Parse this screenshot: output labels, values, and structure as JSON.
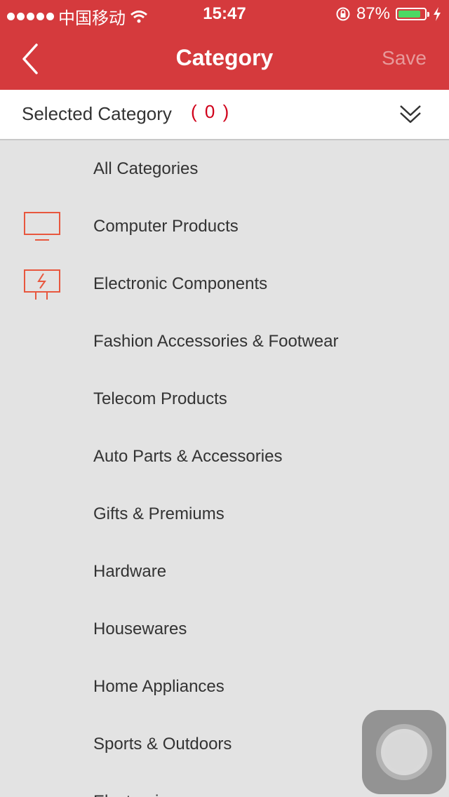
{
  "status_bar": {
    "carrier": "中国移动",
    "time": "15:47",
    "battery": "87%",
    "battery_level": 0.87,
    "signal_icon": "signal-dots-icon",
    "wifi_icon": "wifi-icon",
    "lock_icon": "rotation-lock-icon",
    "charging_icon": "charging-bolt-icon"
  },
  "nav": {
    "title": "Category",
    "save_label": "Save",
    "back_icon": "chevron-left-icon"
  },
  "selected": {
    "label": "Selected Category",
    "count": "( 0 )",
    "expand_icon": "double-chevron-down-icon"
  },
  "categories": [
    {
      "label": "All Categories",
      "icon": ""
    },
    {
      "label": "Computer Products",
      "icon": "monitor-icon"
    },
    {
      "label": "Electronic Components",
      "icon": "circuit-board-icon"
    },
    {
      "label": "Fashion Accessories & Footwear",
      "icon": ""
    },
    {
      "label": "Telecom Products",
      "icon": ""
    },
    {
      "label": "Auto Parts & Accessories",
      "icon": ""
    },
    {
      "label": "Gifts & Premiums",
      "icon": ""
    },
    {
      "label": "Hardware",
      "icon": ""
    },
    {
      "label": "Housewares",
      "icon": ""
    },
    {
      "label": "Home Appliances",
      "icon": ""
    },
    {
      "label": "Sports & Outdoors",
      "icon": ""
    },
    {
      "label": "Electronics",
      "icon": ""
    }
  ],
  "colors": {
    "brand_red": "#d53a3d",
    "icon_orange": "#e8573e",
    "count_red": "#d0021b",
    "list_bg": "#e3e3e3"
  }
}
